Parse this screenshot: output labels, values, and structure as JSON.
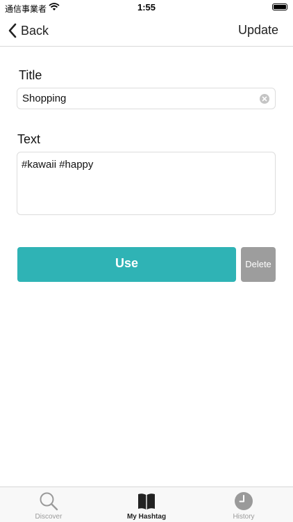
{
  "status_bar": {
    "carrier": "通信事業者",
    "time": "1:55"
  },
  "nav": {
    "back_label": "Back",
    "update_label": "Update"
  },
  "form": {
    "title_label": "Title",
    "title_value": "Shopping",
    "text_label": "Text",
    "text_value": "#kawaii #happy"
  },
  "actions": {
    "use_label": "Use",
    "delete_label": "Delete"
  },
  "tabs": [
    {
      "label": "Discover",
      "icon": "magnifier-icon",
      "active": false
    },
    {
      "label": "My Hashtag",
      "icon": "book-icon",
      "active": true
    },
    {
      "label": "History",
      "icon": "clock-icon",
      "active": false
    }
  ],
  "colors": {
    "use_button": "#2fb3b5",
    "delete_button": "#9d9d9d"
  }
}
